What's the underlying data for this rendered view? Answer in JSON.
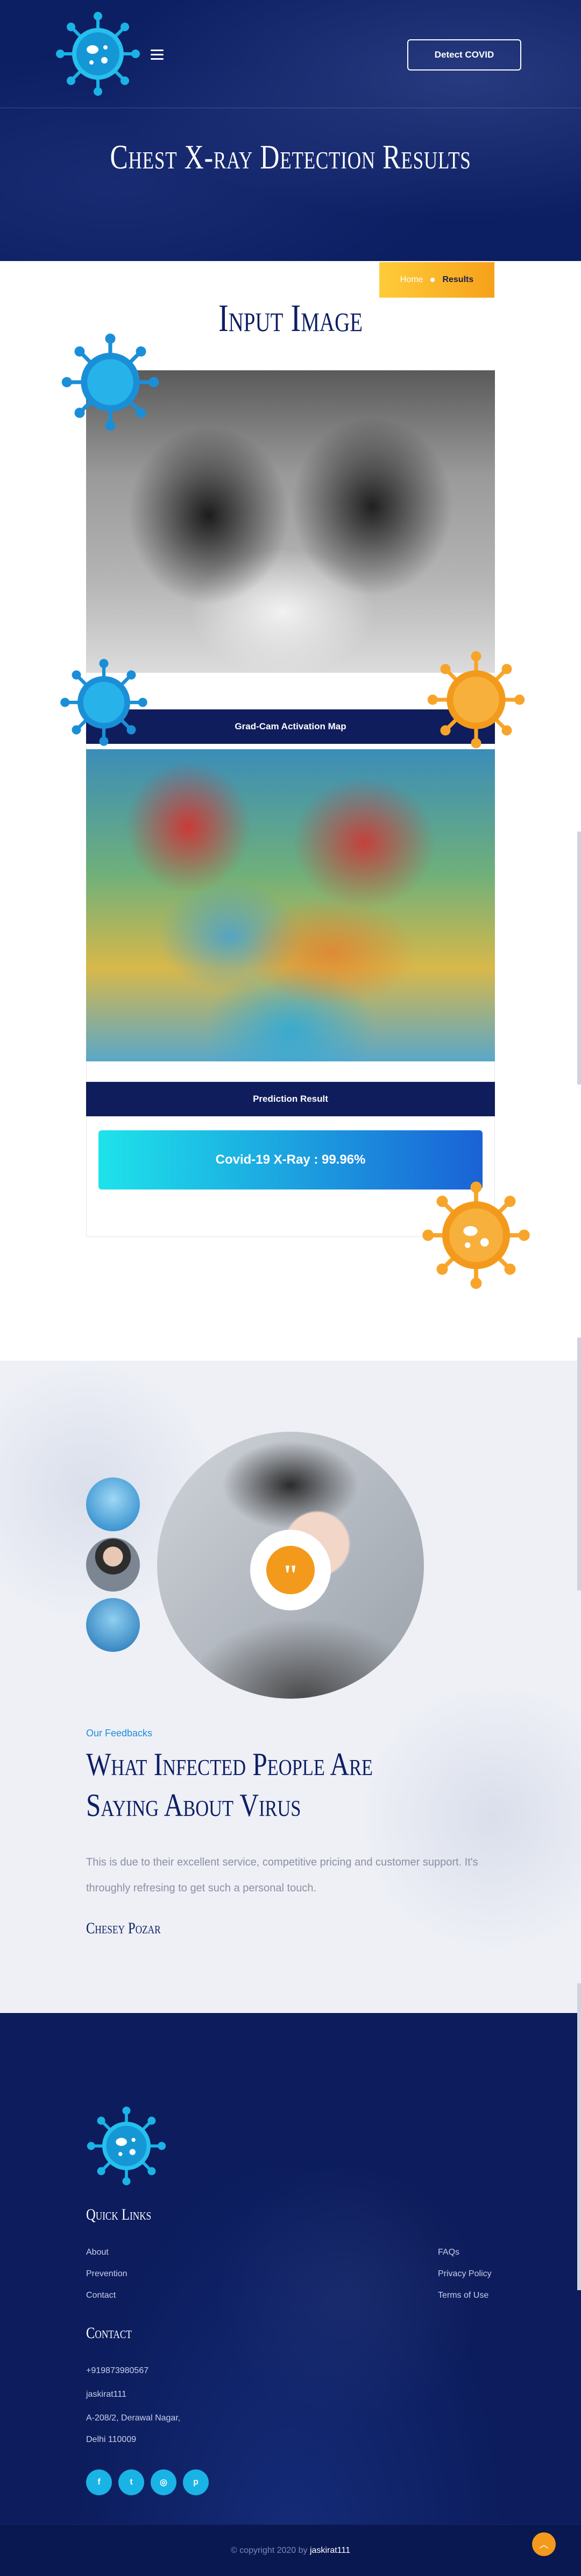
{
  "header": {
    "detect_button": "Detect COVID",
    "menu_icon": "hamburger-menu-icon",
    "logo_icon": "virus-logo-icon",
    "title": "Chest X-ray Detection Results"
  },
  "breadcrumb": {
    "home": "Home",
    "current": "Results"
  },
  "results": {
    "section_title": "Input Image",
    "gradcam_label": "Grad-Cam Activation Map",
    "prediction_label": "Prediction Result",
    "prediction_value": "Covid-19 X-Ray : 99.96%"
  },
  "feedback": {
    "label": "Our Feedbacks",
    "title": "What Infected People Are Saying About Virus",
    "text": "This is due to their excellent service, competitive pricing and customer support. It's throughly refresing to get such a personal touch.",
    "author": "Chesey Pozar",
    "quote_icon": "quote-icon"
  },
  "footer": {
    "quick_links_title": "Quick Links",
    "links_left": [
      "About",
      "Prevention",
      "Contact"
    ],
    "links_right": [
      "FAQs",
      "Privacy Policy",
      "Terms of Use"
    ],
    "contact_title": "Contact",
    "contact": [
      "+919873980567",
      "jaskirat111",
      "A-208/2, Derawal Nagar,",
      "Delhi 110009"
    ],
    "socials": [
      "facebook-icon",
      "twitter-icon",
      "instagram-icon",
      "pinterest-icon"
    ],
    "copyright_prefix": "© copyright 2020 by",
    "copyright_by": "jaskirat111"
  },
  "colors": {
    "navy": "#0d1f63",
    "accent_orange": "#f39a1c",
    "accent_yellow": "#ffcc3a",
    "accent_cyan": "#1ab3e6"
  }
}
